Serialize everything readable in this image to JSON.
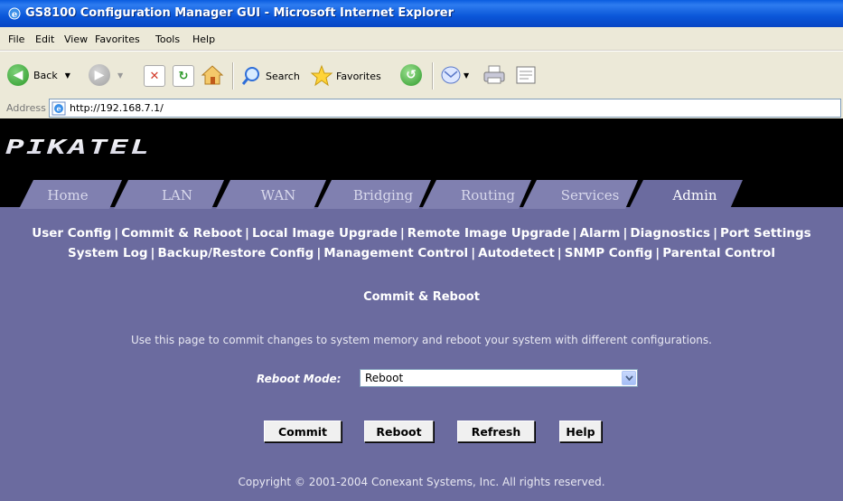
{
  "window": {
    "title": "GS8100 Configuration Manager GUI - Microsoft Internet Explorer"
  },
  "menu": {
    "items": [
      "File",
      "Edit",
      "View",
      "Favorites",
      "Tools",
      "Help"
    ]
  },
  "toolbar": {
    "back_label": "Back",
    "search_label": "Search",
    "favorites_label": "Favorites"
  },
  "address": {
    "label": "Address",
    "url": "http://192.168.7.1/"
  },
  "brand": {
    "logo_text": "PIKATEL"
  },
  "tabs": [
    {
      "label": "Home",
      "active": false
    },
    {
      "label": "LAN",
      "active": false
    },
    {
      "label": "WAN",
      "active": false
    },
    {
      "label": "Bridging",
      "active": false
    },
    {
      "label": "Routing",
      "active": false
    },
    {
      "label": "Services",
      "active": false
    },
    {
      "label": "Admin",
      "active": true
    }
  ],
  "sublinks": {
    "row1": [
      "User Config",
      "Commit & Reboot",
      "Local Image Upgrade",
      "Remote Image Upgrade",
      "Alarm",
      "Diagnostics",
      "Port Settings"
    ],
    "row2": [
      "System Log",
      "Backup/Restore Config",
      "Management Control",
      "Autodetect",
      "SNMP Config",
      "Parental Control"
    ]
  },
  "page": {
    "title": "Commit & Reboot",
    "description": "Use this page to commit changes to system memory and reboot your system with different configurations.",
    "reboot_mode_label": "Reboot Mode:",
    "reboot_mode_value": "Reboot",
    "buttons": {
      "commit": "Commit",
      "reboot": "Reboot",
      "refresh": "Refresh",
      "help": "Help"
    },
    "copyright": "Copyright © 2001-2004 Conexant Systems, Inc. All rights reserved."
  },
  "colors": {
    "content_bg": "#6B6B9F",
    "tab_inactive": "#8080B0",
    "tab_active": "#6B6B9F",
    "titlebar": "#0A56D8"
  }
}
